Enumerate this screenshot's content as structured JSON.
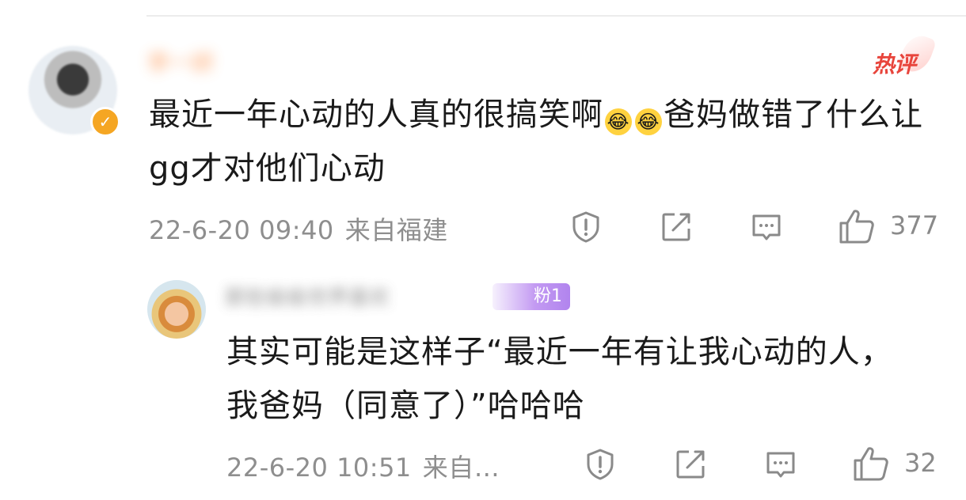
{
  "comment": {
    "username": "李一妍",
    "hot_label": "热评",
    "verified_icon": "check-badge-icon",
    "text_before_emoji": "最近一年心动的人真的很搞笑啊",
    "emoji": [
      "😂",
      "😂"
    ],
    "text_after_emoji": "爸妈做错了什么让gg才对他们心动",
    "time": "22-6-20 09:40",
    "source": "来自福建",
    "likes": "377"
  },
  "reply": {
    "username": "那些偷偷世界喜欢",
    "fan_badge": "粉1",
    "text": "其实可能是这样子“最近一年有让我心动的人，我爸妈（同意了）”哈哈哈",
    "time": "22-6-20 10:51",
    "source": "来自…",
    "likes": "32"
  },
  "colors": {
    "hot": "#e8453c",
    "meta": "#8e8e8e",
    "fan_badge": "#c39af2",
    "verified": "#f5a623"
  }
}
